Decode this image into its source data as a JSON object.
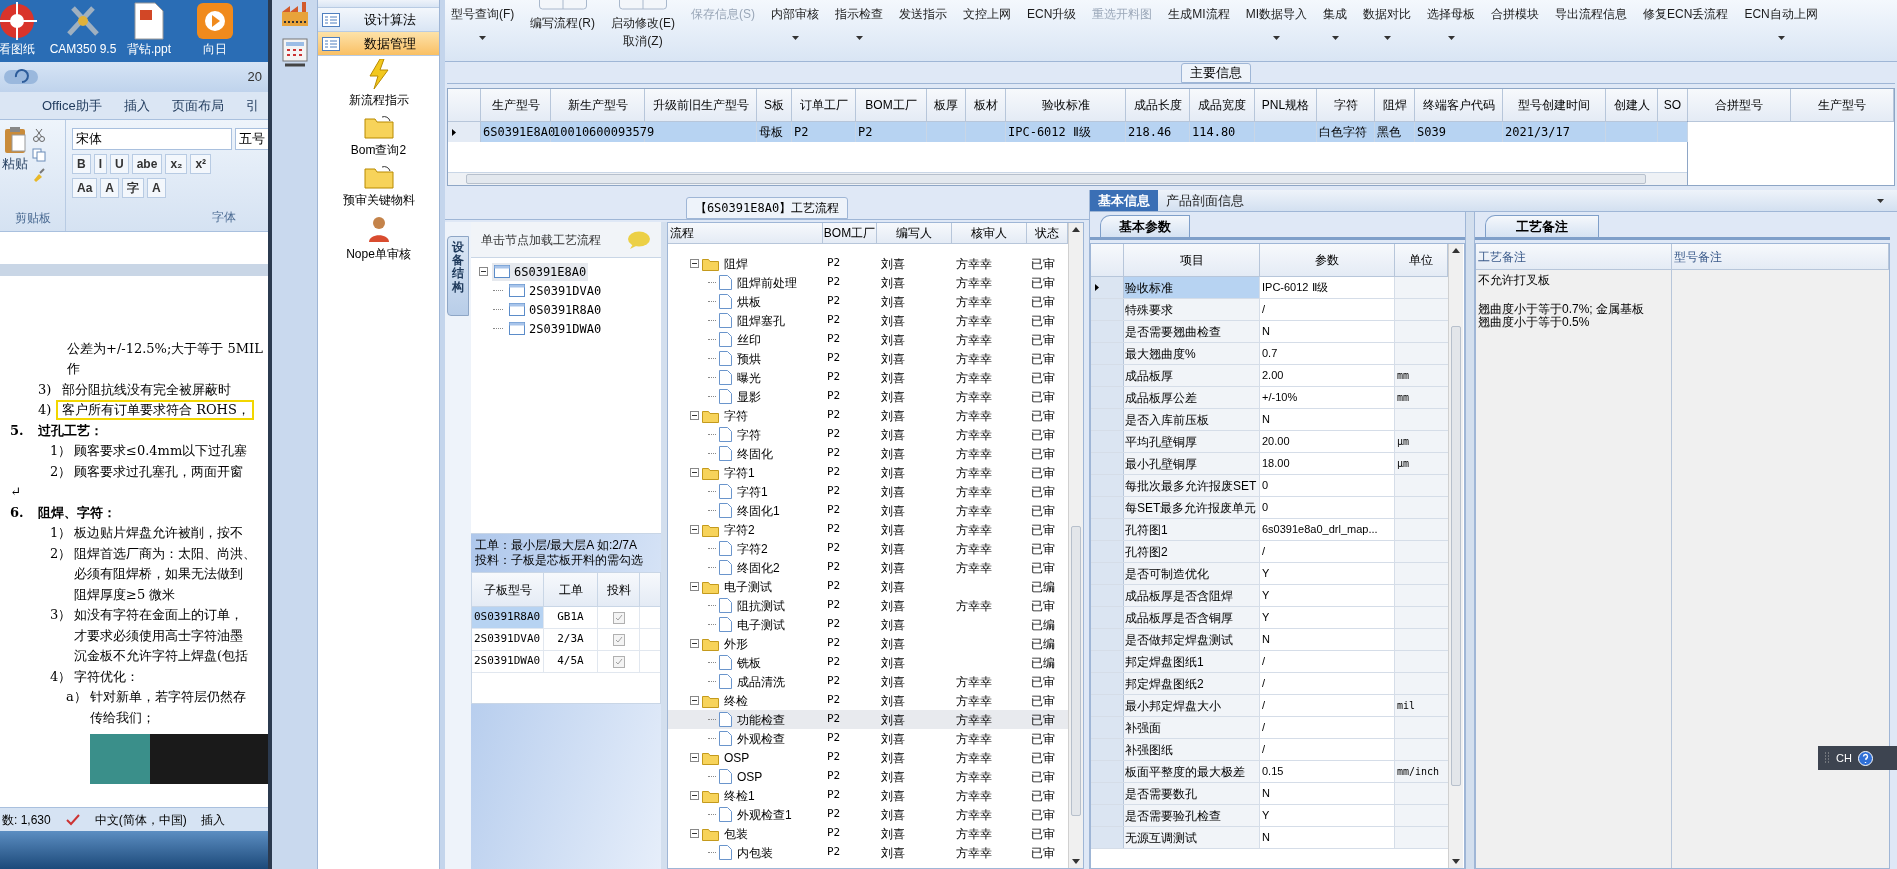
{
  "desktop": {
    "icons": [
      {
        "label": "看图纸"
      },
      {
        "label": "CAM350 9.5"
      },
      {
        "label": "背钻.ppt"
      },
      {
        "label": "向日"
      }
    ]
  },
  "word": {
    "title": "20",
    "ribbon_tabs": [
      "Office助手",
      "插入",
      "页面布局",
      "引"
    ],
    "paste_label": "粘贴",
    "font_name": "宋体",
    "font_size": "五号",
    "format_row1": [
      "B",
      "I",
      "U",
      "abe",
      "x₂",
      "x²"
    ],
    "format_row2": [
      "Aa",
      "A",
      "字",
      "A"
    ],
    "groups": [
      "剪贴板",
      "字体"
    ],
    "lines": [
      {
        "kind": "cont",
        "text": "公差为+/-12.5%;大于等于 5MIL",
        "highlighted": false
      },
      {
        "kind": "cont",
        "text": "作",
        "highlighted": false
      },
      {
        "kind": "item",
        "num": "3)",
        "text": "部分阻抗线没有完全被屏蔽时",
        "highlighted": false
      },
      {
        "kind": "item",
        "num": "4)",
        "text": "客户所有订单要求符合 ROHS，",
        "highlighted": true
      },
      {
        "kind": "heading",
        "num": "5.",
        "text": "过孔工艺：",
        "highlighted": false
      },
      {
        "kind": "sub",
        "num": "1）",
        "text": "顾客要求≤0.4mm以下过孔塞",
        "highlighted": false
      },
      {
        "kind": "sub",
        "num": "2）",
        "text": "顾客要求过孔塞孔，两面开窗",
        "highlighted": false
      },
      {
        "kind": "blank",
        "text": "↵",
        "highlighted": false
      },
      {
        "kind": "heading",
        "num": "6.",
        "text": "阻焊、字符：",
        "highlighted": false
      },
      {
        "kind": "sub",
        "num": "1）",
        "text": "板边贴片焊盘允许被削，按不",
        "highlighted": false
      },
      {
        "kind": "sub",
        "num": "2）",
        "text": "阻焊首选厂商为：太阳、尚洪、",
        "highlighted": false
      },
      {
        "kind": "subcont",
        "text": "必须有阻焊桥，如果无法做到",
        "highlighted": false
      },
      {
        "kind": "subcont",
        "text": "阻焊厚度≥5 微米",
        "highlighted": false
      },
      {
        "kind": "sub",
        "num": "3）",
        "text": "如没有字符在金面上的订单，",
        "highlighted": false
      },
      {
        "kind": "subcont",
        "text": "才要求必须使用高士字符油墨",
        "highlighted": false
      },
      {
        "kind": "subcont",
        "text": "沉金板不允许字符上焊盘(包括",
        "highlighted": false
      },
      {
        "kind": "sub",
        "num": "4）",
        "text": "字符优化：",
        "highlighted": false
      },
      {
        "kind": "deep",
        "num": "a）",
        "text": "针对新单，若字符层仍然存",
        "highlighted": false
      },
      {
        "kind": "deepcont",
        "text": "传给我们；",
        "highlighted": false
      }
    ],
    "status": [
      "数: 1,630",
      "中文(简体，中国)",
      "插入"
    ]
  },
  "nav": {
    "items": [
      {
        "label": "设计算法",
        "selected": false
      },
      {
        "label": "数据管理",
        "selected": true
      }
    ],
    "tools": [
      {
        "label": "新流程指示",
        "kind": "bolt"
      },
      {
        "label": "Bom查询2",
        "kind": "folder"
      },
      {
        "label": "预审关键物料",
        "kind": "folder"
      },
      {
        "label": "Nope单审核",
        "kind": "person"
      }
    ]
  },
  "toolbar": [
    {
      "label": "型号查询(F)",
      "kind": "plain",
      "dropdown": true,
      "disabled": false
    },
    {
      "label": "编写流程(R)",
      "kind": "stacked",
      "dropdown": false,
      "disabled": false
    },
    {
      "label": "启动修改(E)",
      "sublabel": "取消(Z)",
      "kind": "stacked",
      "dropdown": false,
      "disabled": false
    },
    {
      "label": "保存信息(S)",
      "kind": "plain",
      "dropdown": false,
      "disabled": true
    },
    {
      "label": "内部审核",
      "kind": "plain",
      "dropdown": true,
      "disabled": false
    },
    {
      "label": "指示检查",
      "kind": "plain",
      "dropdown": true,
      "disabled": false
    },
    {
      "label": "发送指示",
      "kind": "plain",
      "dropdown": false,
      "disabled": false
    },
    {
      "label": "文控上网",
      "kind": "plain",
      "dropdown": false,
      "disabled": false
    },
    {
      "label": "ECN升级",
      "kind": "plain",
      "dropdown": false,
      "disabled": false
    },
    {
      "label": "重选开料图",
      "kind": "plain",
      "dropdown": false,
      "disabled": true
    },
    {
      "label": "生成MI流程",
      "kind": "plain",
      "dropdown": false,
      "disabled": false
    },
    {
      "label": "MI数据导入",
      "kind": "plain",
      "dropdown": true,
      "disabled": false
    },
    {
      "label": "集成",
      "kind": "plain",
      "dropdown": true,
      "disabled": false
    },
    {
      "label": "数据对比",
      "kind": "plain",
      "dropdown": true,
      "disabled": false
    },
    {
      "label": "选择母板",
      "kind": "plain",
      "dropdown": true,
      "disabled": false
    },
    {
      "label": "合拼模块",
      "kind": "plain",
      "dropdown": false,
      "disabled": false
    },
    {
      "label": "导出流程信息",
      "kind": "plain",
      "dropdown": false,
      "disabled": false
    },
    {
      "label": "修复ECN丢流程",
      "kind": "plain",
      "dropdown": false,
      "disabled": false
    },
    {
      "label": "ECN自动上网",
      "kind": "plain",
      "dropdown": true,
      "disabled": false
    }
  ],
  "main_info": {
    "title": "主要信息",
    "columns": [
      "生产型号",
      "新生产型号",
      "升级前旧生产型号",
      "S板",
      "订单工厂",
      "BOM工厂",
      "板厚",
      "板材",
      "验收标准",
      "成品长度",
      "成品宽度",
      "PNL规格",
      "字符",
      "阻焊",
      "终端客户代码",
      "型号创建时间",
      "创建人",
      "SO"
    ],
    "rows": [
      {
        "selected": true,
        "cells": [
          "6S0391E8A0",
          "10010600093579",
          null,
          "母板",
          "P2",
          "P2",
          null,
          null,
          "IPC-6012 Ⅱ级",
          "218.46",
          "114.80",
          null,
          "白色字符",
          "黑色",
          "S039",
          "2021/3/17",
          null,
          null
        ]
      }
    ],
    "merge_columns": [
      "合拼型号",
      "生产型号"
    ]
  },
  "flow": {
    "title": "【6S0391E8A0】工艺流程",
    "side_tab": "设备结构",
    "tree_hint": "单击节点加载工艺流程",
    "tree": [
      {
        "label": "6S0391E8A0",
        "expanded": true,
        "selected": true,
        "children": [
          {
            "label": "2S0391DVA0",
            "selected": false
          },
          {
            "label": "0S0391R8A0",
            "selected": false
          },
          {
            "label": "2S0391DWA0",
            "selected": false
          }
        ]
      }
    ],
    "notes": [
      "工单：最小层/最大层A 如:2/7A",
      "投料：子板是芯板开料的需勾选"
    ],
    "sub_table": {
      "columns": [
        "子板型号",
        "工单",
        "投料"
      ],
      "rows": [
        {
          "model": "0S0391R8A0",
          "order": "GB1A",
          "feed": true,
          "selected": true
        },
        {
          "model": "2S0391DVA0",
          "order": "2/3A",
          "feed": true,
          "selected": false
        },
        {
          "model": "2S0391DWA0",
          "order": "4/5A",
          "feed": true,
          "selected": false
        }
      ]
    },
    "steps": {
      "columns": [
        "流程",
        "BOM工厂",
        "编写人",
        "核审人",
        "状态"
      ],
      "rows": [
        {
          "name": "阻焊",
          "bom": "P2",
          "writer": "刘喜",
          "reviewer": "方幸幸",
          "status": "已审",
          "expanded": true,
          "selected": false,
          "children": [
            {
              "name": "阻焊前处理",
              "bom": "P2",
              "writer": "刘喜",
              "reviewer": "方幸幸",
              "status": "已审",
              "selected": false
            },
            {
              "name": "烘板",
              "bom": "P2",
              "writer": "刘喜",
              "reviewer": "方幸幸",
              "status": "已审",
              "selected": false
            },
            {
              "name": "阻焊塞孔",
              "bom": "P2",
              "writer": "刘喜",
              "reviewer": "方幸幸",
              "status": "已审",
              "selected": false
            },
            {
              "name": "丝印",
              "bom": "P2",
              "writer": "刘喜",
              "reviewer": "方幸幸",
              "status": "已审",
              "selected": false
            },
            {
              "name": "预烘",
              "bom": "P2",
              "writer": "刘喜",
              "reviewer": "方幸幸",
              "status": "已审",
              "selected": false
            },
            {
              "name": "曝光",
              "bom": "P2",
              "writer": "刘喜",
              "reviewer": "方幸幸",
              "status": "已审",
              "selected": false
            },
            {
              "name": "显影",
              "bom": "P2",
              "writer": "刘喜",
              "reviewer": "方幸幸",
              "status": "已审",
              "selected": false
            }
          ]
        },
        {
          "name": "字符",
          "bom": "P2",
          "writer": "刘喜",
          "reviewer": "方幸幸",
          "status": "已审",
          "expanded": true,
          "selected": false,
          "children": [
            {
              "name": "字符",
              "bom": "P2",
              "writer": "刘喜",
              "reviewer": "方幸幸",
              "status": "已审",
              "selected": false
            },
            {
              "name": "终固化",
              "bom": "P2",
              "writer": "刘喜",
              "reviewer": "方幸幸",
              "status": "已审",
              "selected": false
            }
          ]
        },
        {
          "name": "字符1",
          "bom": "P2",
          "writer": "刘喜",
          "reviewer": "方幸幸",
          "status": "已审",
          "expanded": true,
          "selected": false,
          "children": [
            {
              "name": "字符1",
              "bom": "P2",
              "writer": "刘喜",
              "reviewer": "方幸幸",
              "status": "已审",
              "selected": false
            },
            {
              "name": "终固化1",
              "bom": "P2",
              "writer": "刘喜",
              "reviewer": "方幸幸",
              "status": "已审",
              "selected": false
            }
          ]
        },
        {
          "name": "字符2",
          "bom": "P2",
          "writer": "刘喜",
          "reviewer": "方幸幸",
          "status": "已审",
          "expanded": true,
          "selected": false,
          "children": [
            {
              "name": "字符2",
              "bom": "P2",
              "writer": "刘喜",
              "reviewer": "方幸幸",
              "status": "已审",
              "selected": false
            },
            {
              "name": "终固化2",
              "bom": "P2",
              "writer": "刘喜",
              "reviewer": "方幸幸",
              "status": "已审",
              "selected": false
            }
          ]
        },
        {
          "name": "电子测试",
          "bom": "P2",
          "writer": "刘喜",
          "status": "已编",
          "expanded": true,
          "selected": false,
          "children": [
            {
              "name": "阻抗测试",
              "bom": "P2",
              "writer": "刘喜",
              "reviewer": "方幸幸",
              "status": "已审",
              "selected": false
            },
            {
              "name": "电子测试",
              "bom": "P2",
              "writer": "刘喜",
              "status": "已编",
              "selected": false
            }
          ]
        },
        {
          "name": "外形",
          "bom": "P2",
          "writer": "刘喜",
          "status": "已编",
          "expanded": true,
          "selected": false,
          "children": [
            {
              "name": "铣板",
              "bom": "P2",
              "writer": "刘喜",
              "status": "已编",
              "selected": false
            },
            {
              "name": "成品清洗",
              "bom": "P2",
              "writer": "刘喜",
              "reviewer": "方幸幸",
              "status": "已审",
              "selected": false
            }
          ]
        },
        {
          "name": "终检",
          "bom": "P2",
          "writer": "刘喜",
          "reviewer": "方幸幸",
          "status": "已审",
          "expanded": true,
          "selected": false,
          "children": [
            {
              "name": "功能检查",
              "bom": "P2",
              "writer": "刘喜",
              "reviewer": "方幸幸",
              "status": "已审",
              "selected": true
            },
            {
              "name": "外观检查",
              "bom": "P2",
              "writer": "刘喜",
              "reviewer": "方幸幸",
              "status": "已审",
              "selected": false
            }
          ]
        },
        {
          "name": "OSP",
          "bom": "P2",
          "writer": "刘喜",
          "reviewer": "方幸幸",
          "status": "已审",
          "expanded": true,
          "selected": false,
          "children": [
            {
              "name": "OSP",
              "bom": "P2",
              "writer": "刘喜",
              "reviewer": "方幸幸",
              "status": "已审",
              "selected": false
            }
          ]
        },
        {
          "name": "终检1",
          "bom": "P2",
          "writer": "刘喜",
          "reviewer": "方幸幸",
          "status": "已审",
          "expanded": true,
          "selected": false,
          "children": [
            {
              "name": "外观检查1",
              "bom": "P2",
              "writer": "刘喜",
              "reviewer": "方幸幸",
              "status": "已审",
              "selected": false
            }
          ]
        },
        {
          "name": "包装",
          "bom": "P2",
          "writer": "刘喜",
          "reviewer": "方幸幸",
          "status": "已审",
          "expanded": true,
          "selected": false,
          "children": [
            {
              "name": "内包装",
              "bom": "P2",
              "writer": "刘喜",
              "reviewer": "方幸幸",
              "status": "已审",
              "selected": false
            }
          ]
        }
      ]
    }
  },
  "detail": {
    "tabs": [
      {
        "label": "基本信息",
        "selected": true
      },
      {
        "label": "产品剖面信息",
        "selected": false
      }
    ],
    "params": {
      "tab": "基本参数",
      "columns": [
        "项目",
        "参数",
        "单位"
      ],
      "rows": [
        {
          "item": "验收标准",
          "value": "IPC-6012 Ⅱ级",
          "selected": true
        },
        {
          "item": "特殊要求",
          "value": "/",
          "selected": false
        },
        {
          "item": "是否需要翘曲检查",
          "value": "N",
          "selected": false
        },
        {
          "item": "最大翘曲度%",
          "value": "0.7",
          "selected": false
        },
        {
          "item": "成品板厚",
          "value": "2.00",
          "unit": "mm",
          "selected": false
        },
        {
          "item": "成品板厚公差",
          "value": "+/-10%",
          "unit": "mm",
          "selected": false
        },
        {
          "item": "是否入库前压板",
          "value": "N",
          "selected": false
        },
        {
          "item": "平均孔壁铜厚",
          "value": "20.00",
          "unit": "μm",
          "selected": false
        },
        {
          "item": "最小孔壁铜厚",
          "value": "18.00",
          "unit": "μm",
          "selected": false
        },
        {
          "item": "每批次最多允许报废SET",
          "value": "0",
          "selected": false
        },
        {
          "item": "每SET最多允许报废单元",
          "value": "0",
          "selected": false
        },
        {
          "item": "孔符图1",
          "value": "6s0391e8a0_drl_map...",
          "selected": false
        },
        {
          "item": "孔符图2",
          "value": "/",
          "selected": false
        },
        {
          "item": "是否可制造优化",
          "value": "Y",
          "selected": false
        },
        {
          "item": "成品板厚是否含阻焊",
          "value": "Y",
          "selected": false
        },
        {
          "item": "成品板厚是否含铜厚",
          "value": "Y",
          "selected": false
        },
        {
          "item": "是否做邦定焊盘测试",
          "value": "N",
          "selected": false
        },
        {
          "item": "邦定焊盘图纸1",
          "value": "/",
          "selected": false
        },
        {
          "item": "邦定焊盘图纸2",
          "value": "/",
          "selected": false
        },
        {
          "item": "最小邦定焊盘大小",
          "value": "/",
          "unit": "mil",
          "selected": false
        },
        {
          "item": "补强面",
          "value": "/",
          "selected": false
        },
        {
          "item": "补强图纸",
          "value": "/",
          "selected": false
        },
        {
          "item": "板面平整度的最大极差",
          "value": "0.15",
          "unit": "mm/inch",
          "selected": false
        },
        {
          "item": "是否需要数孔",
          "value": "N",
          "selected": false
        },
        {
          "item": "是否需要验孔检查",
          "value": "Y",
          "selected": false
        },
        {
          "item": "无源互调测试",
          "value": "N",
          "selected": false
        }
      ]
    },
    "remarks": {
      "tab": "工艺备注",
      "columns": [
        "工艺备注",
        "型号备注"
      ],
      "process_note": [
        [
          "不允许打叉板"
        ],
        [
          "翘曲度小于等于0.7%; 金属基板",
          "翘曲度小于等于0.5%"
        ]
      ]
    }
  },
  "ime": {
    "label": "CH"
  }
}
